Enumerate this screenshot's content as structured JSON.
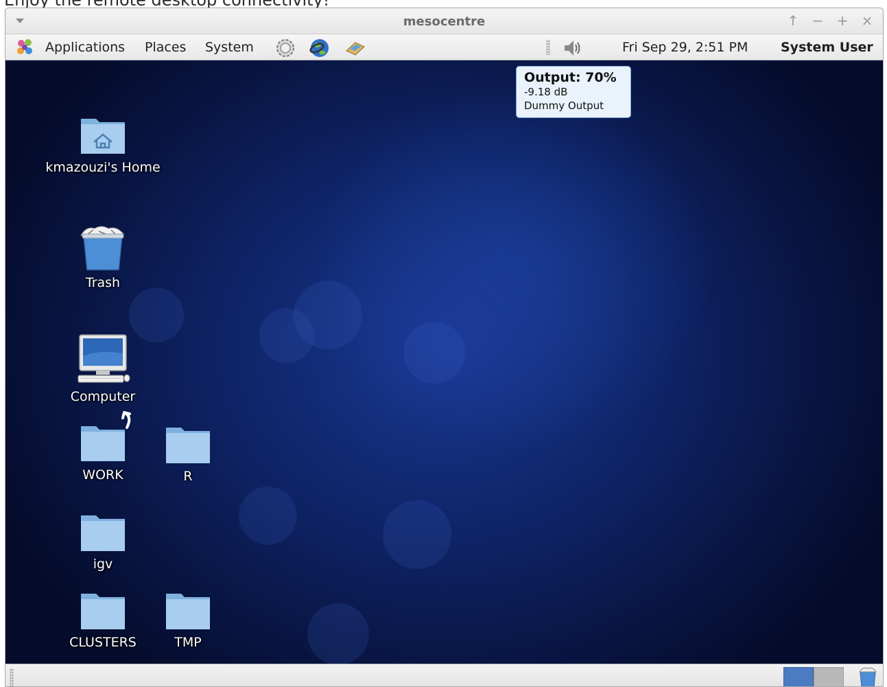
{
  "page_caption": "Enjoy the remote desktop connectivity!",
  "window": {
    "title": "mesocentre",
    "controls": [
      "↑",
      "−",
      "+",
      "×"
    ]
  },
  "panel": {
    "menus": [
      "Applications",
      "Places",
      "System"
    ],
    "launchers": [
      "settings-gear-icon",
      "web-browser-icon",
      "mail-client-icon"
    ],
    "volume_icon": "speaker-icon",
    "clock": "Fri Sep 29,  2:51 PM",
    "user": "System User"
  },
  "tooltip": {
    "title": "Output: 70%",
    "db": "-9.18 dB",
    "device": "Dummy Output",
    "volume_percent": 70
  },
  "desktop_icons": [
    {
      "label": "kmazouzi's Home",
      "icon": "home-folder-icon"
    },
    {
      "label": "Trash",
      "icon": "trash-icon"
    },
    {
      "label": "Computer",
      "icon": "computer-icon"
    },
    {
      "label": "WORK",
      "icon": "folder-link-icon"
    },
    {
      "label": "R",
      "icon": "folder-icon"
    },
    {
      "label": "igv",
      "icon": "folder-icon"
    },
    {
      "label": "CLUSTERS",
      "icon": "folder-icon"
    },
    {
      "label": "TMP",
      "icon": "folder-icon"
    }
  ],
  "bottom_panel": {
    "workspaces": 2,
    "active_workspace": 1
  },
  "colors": {
    "desktop": "#0f2467",
    "folder": "#a9cdee",
    "tooltip_bg": "#eaf2fb"
  }
}
